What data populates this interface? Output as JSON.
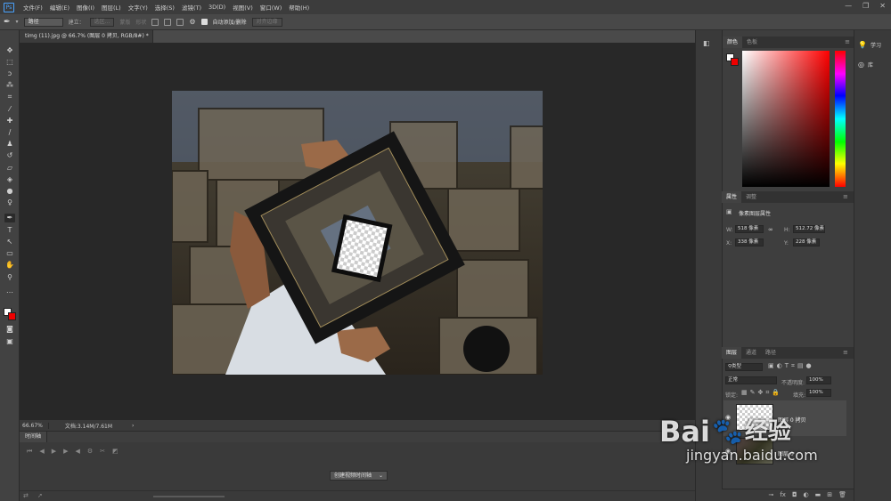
{
  "app": {
    "logo": "Ps"
  },
  "menu": [
    "文件(F)",
    "编辑(E)",
    "图像(I)",
    "图层(L)",
    "文字(Y)",
    "选择(S)",
    "滤镜(T)",
    "3D(D)",
    "视图(V)",
    "窗口(W)",
    "帮助(H)"
  ],
  "window_controls": [
    "—",
    "❐",
    "✕"
  ],
  "options": {
    "tool_mode": "路径",
    "make_label": "建立：",
    "selection_btn": "选区...",
    "mask_btn": "蒙版",
    "shape_btn": "形状",
    "auto_add_delete": "自动添加/删除",
    "align_edges": "对齐边缘"
  },
  "document_tab": {
    "title": "timg (11).jpg @ 66.7% (图层 0 拷贝, RGB/8#) *",
    "close": "×"
  },
  "status": {
    "zoom": "66.67%",
    "doc_info": "文档:3.14M/7.61M",
    "arrow": "›"
  },
  "timeline": {
    "tab": "时间轴",
    "create_button": "创建视频时间轴",
    "dropdown_arrow": "⌄"
  },
  "color_panel": {
    "tabs": [
      "颜色",
      "色板"
    ],
    "colors": {
      "foreground": "#ffffff",
      "background": "#e00000"
    }
  },
  "properties_panel": {
    "tabs": [
      "属性",
      "调整"
    ],
    "kind": "像素图层属性",
    "w_label": "W:",
    "w_value": "518 像素",
    "h_label": "H:",
    "h_value": "512.72 像素",
    "x_label": "X:",
    "x_value": "338 像素",
    "y_label": "Y:",
    "y_value": "228 像素",
    "link_icon": "∞"
  },
  "layers_panel": {
    "tabs": [
      "图层",
      "通道",
      "路径"
    ],
    "filter_kind": "类型",
    "blend_mode": "正常",
    "opacity_label": "不透明度:",
    "opacity_value": "100%",
    "lock_label": "锁定:",
    "fill_label": "填充:",
    "fill_value": "100%",
    "layers": [
      {
        "name": "图层 0 拷贝",
        "visible": true
      },
      {
        "name": "图层 0",
        "visible": true
      }
    ],
    "footer_icons": [
      "link-icon",
      "fx-icon",
      "mask-icon",
      "adjustment-icon",
      "group-icon",
      "new-layer-icon",
      "trash-icon"
    ]
  },
  "right_sidebar": {
    "items": [
      {
        "label": "学习",
        "icon": "lightbulb-icon"
      },
      {
        "label": "库",
        "icon": "library-icon"
      }
    ]
  },
  "watermark": {
    "brand": "Bai",
    "brand2": "经验",
    "url": "jingyan.baidu.com"
  }
}
